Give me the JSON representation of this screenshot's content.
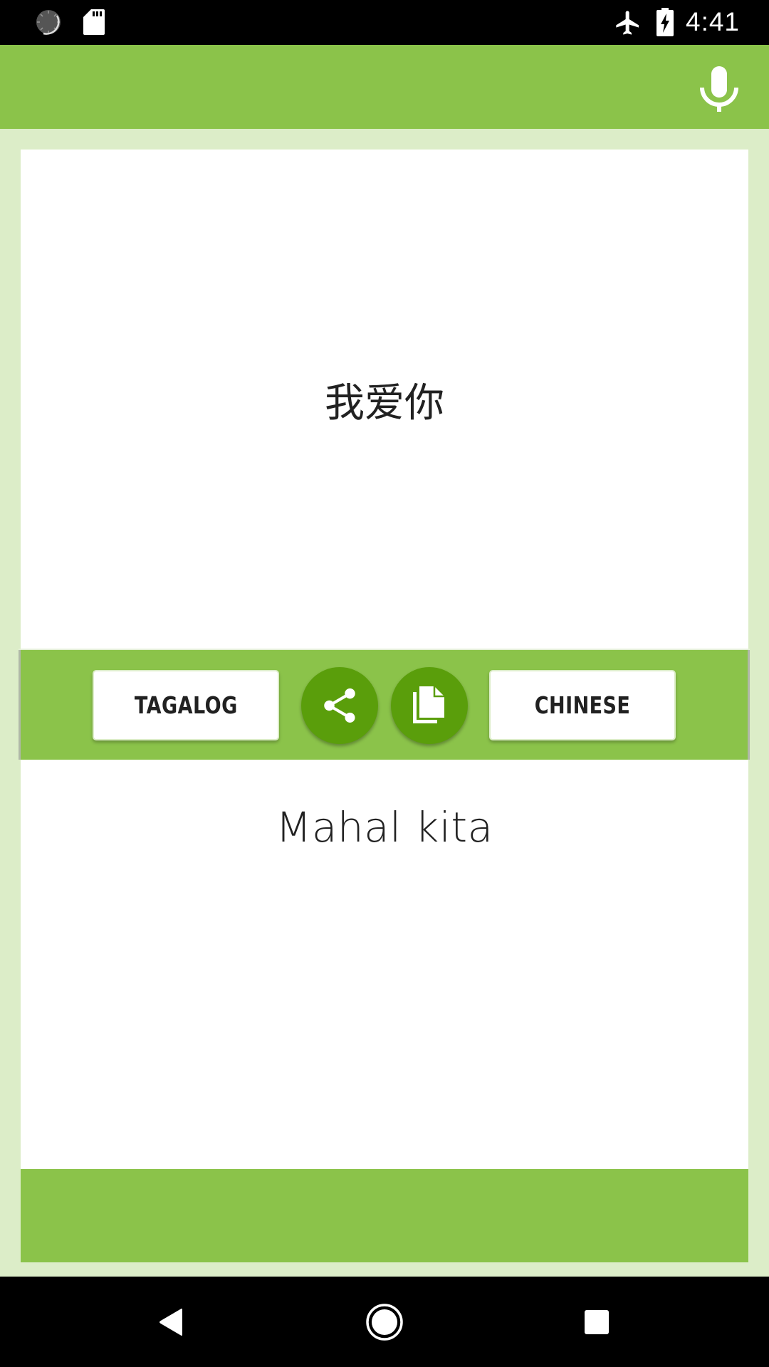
{
  "status_bar": {
    "time": "4:41",
    "left_icons": [
      "sync-spinner-icon",
      "sd-card-icon"
    ],
    "right_icons": [
      "airplane-mode-icon",
      "battery-charging-icon"
    ]
  },
  "app_bar": {
    "action_icon": "microphone-icon"
  },
  "translator": {
    "source_text": "我爱你",
    "target_text": "Mahal kita",
    "source_language": "TAGALOG",
    "target_language": "CHINESE",
    "share_icon": "share-icon",
    "copy_icon": "copy-icon"
  },
  "navigation": {
    "buttons": [
      "back",
      "home",
      "recents"
    ]
  },
  "colors": {
    "primary": "#8bc34a",
    "primary_dark": "#5a9e0b",
    "background": "#dcedc8",
    "card": "#ffffff",
    "text": "#212121"
  }
}
